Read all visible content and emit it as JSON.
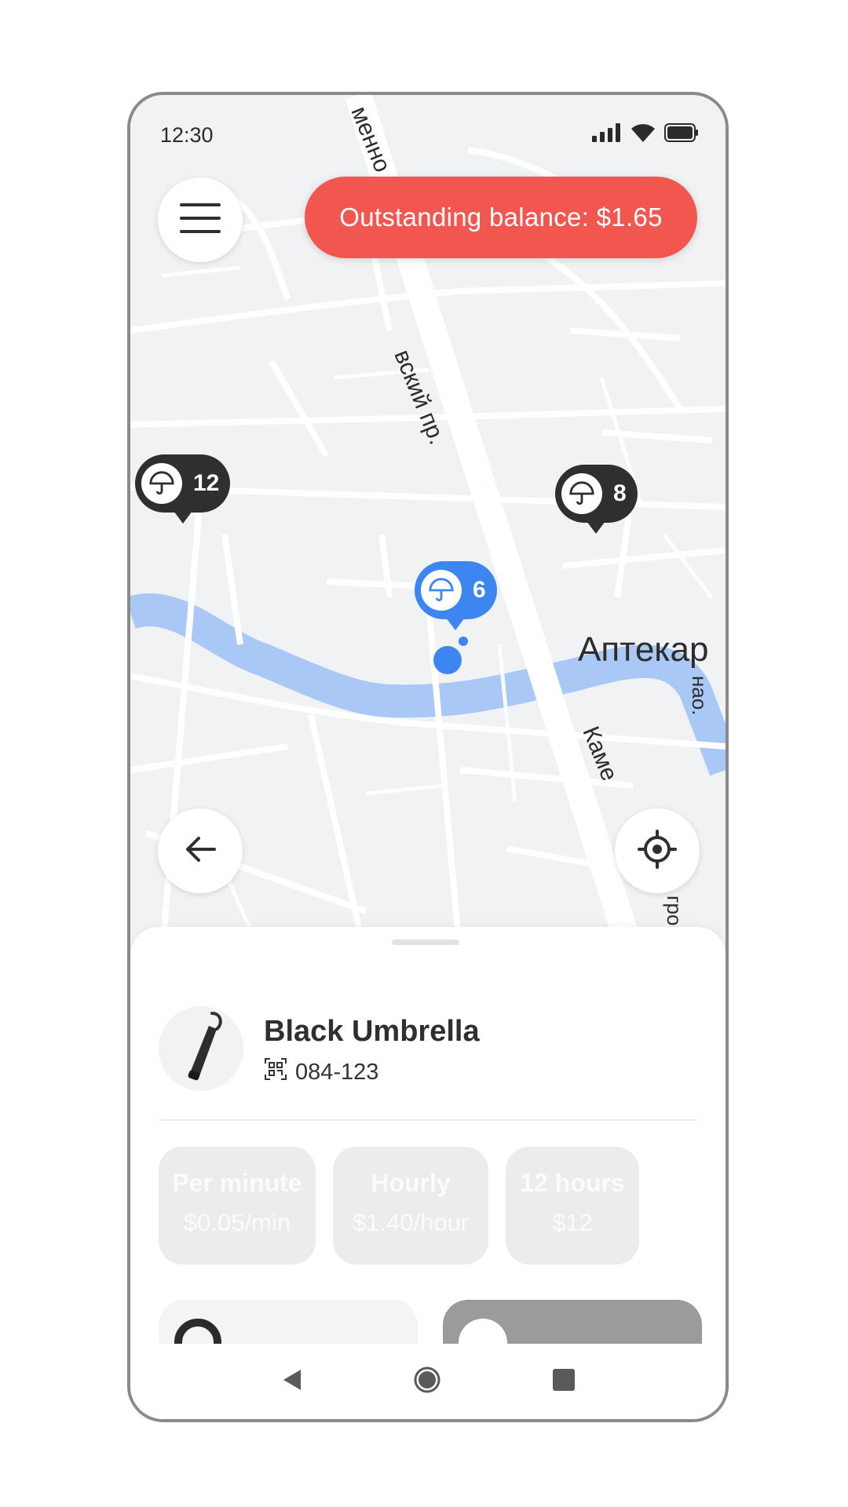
{
  "status_bar": {
    "time": "12:30"
  },
  "map": {
    "balance_text": "Outstanding balance: $1.65",
    "street_labels": [
      "Аптекар",
      "Каме",
      "вский пр.",
      "менно",
      "нао.",
      "гро"
    ],
    "pins": [
      {
        "count": "12",
        "style": "dark"
      },
      {
        "count": "8",
        "style": "dark"
      },
      {
        "count": "6",
        "style": "selected"
      }
    ],
    "colors": {
      "map_bg": "#f1f2f4",
      "road": "#ffffff",
      "river": "#a9c8f5",
      "balance": "#f2574f",
      "selected": "#3d86f1",
      "pin_dark": "#2f2f2f"
    }
  },
  "sheet": {
    "item": {
      "name": "Black Umbrella",
      "code": "084-123"
    },
    "tariffs": [
      {
        "title": "Per minute",
        "price": "$0.05/min"
      },
      {
        "title": "Hourly",
        "price": "$1.40/hour"
      },
      {
        "title": "12 hours",
        "price": "$12"
      }
    ]
  },
  "icons": [
    "menu-icon",
    "back-arrow-icon",
    "locate-icon",
    "umbrella-icon",
    "qr-code-icon",
    "signal-icon",
    "wifi-icon",
    "battery-icon",
    "nav-back-icon",
    "nav-home-icon",
    "nav-recent-icon"
  ]
}
